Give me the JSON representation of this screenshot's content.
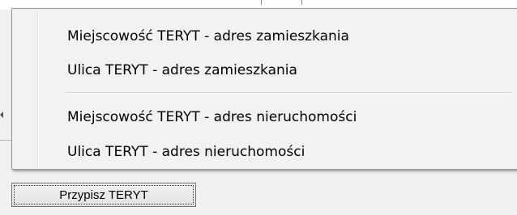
{
  "context_menu": {
    "items": [
      {
        "label": "Miejscowość TERYT - adres zamieszkania"
      },
      {
        "label": "Ulica TERYT - adres zamieszkania"
      },
      {
        "label": "Miejscowość TERYT - adres nieruchomości"
      },
      {
        "label": "Ulica TERYT - adres nieruchomości"
      }
    ]
  },
  "button": {
    "label": "Przypisz TERYT"
  }
}
